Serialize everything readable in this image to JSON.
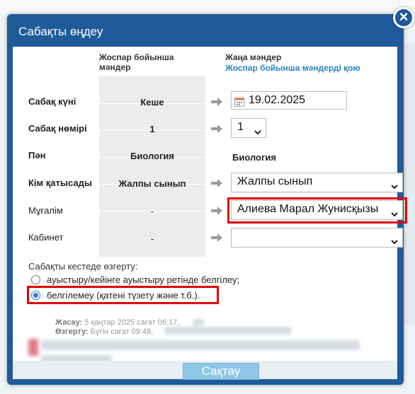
{
  "dialog": {
    "title": "Сабақты өңдеу",
    "close_icon": "×"
  },
  "columns": {
    "plan_header": "Жоспар бойынша мәндер",
    "new_header": "Жаңа мәндер",
    "restore_link": "Жоспар бойынша мәндерді қою"
  },
  "rows": {
    "date": {
      "label": "Сабақ күні",
      "plan": "Кеше",
      "value": "19.02.2025"
    },
    "number": {
      "label": "Сабақ нөмірі",
      "plan": "1",
      "value": "1"
    },
    "subject": {
      "label": "Пән",
      "plan": "Биология",
      "value": "Биология"
    },
    "attendees": {
      "label": "Кім қатысады",
      "plan": "Жалпы сынып",
      "value": "Жалпы сынып"
    },
    "teacher": {
      "label": "Мұғалім",
      "plan": "-",
      "value": "Алиева Марал Жунисқызы"
    },
    "room": {
      "label": "Кабинет",
      "plan": "-",
      "value": ""
    }
  },
  "schedule_change": {
    "label": "Сабақты кестеде өзгерту:",
    "options": [
      {
        "label": "ауыстыру/кейінге ауыстыру ретінде белгілеу;",
        "checked": false
      },
      {
        "label": "белгілемеу (қатені түзету және т.б.).",
        "checked": true
      }
    ]
  },
  "meta": {
    "created_label": "Жасау:",
    "created_value": "5 қаңтар 2025 сағат 06:17,",
    "modified_label": "Өзгерту:",
    "modified_value": "Бүгін сағат 09:48,"
  },
  "footer": {
    "save_label": "Сақтау"
  },
  "colors": {
    "accent": "#1f5a9a",
    "highlight": "#e00000",
    "link": "#2b82c0",
    "save_button": "#8ec6e6"
  }
}
